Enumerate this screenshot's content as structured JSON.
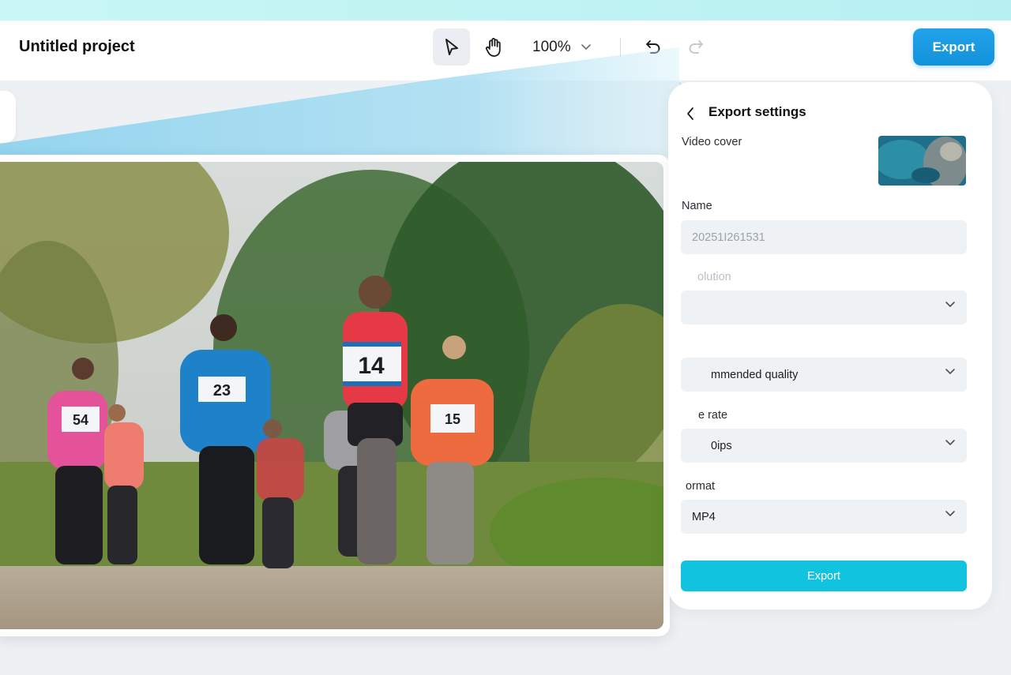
{
  "header": {
    "project_title": "Untitled project",
    "zoom_value": "100%",
    "export_label": "Export"
  },
  "export_panel": {
    "title": "Export settings",
    "video_cover_label": "Video cover",
    "name_label": "Name",
    "name_value": "20251I261531",
    "resolution_label": "olution",
    "resolution_value": "",
    "quality_label": "",
    "quality_value": "mmended quality",
    "frame_rate_label": "e rate",
    "frame_rate_value": "0ips",
    "format_label": "ormat",
    "format_value": "MP4",
    "export_button": "Export"
  },
  "colors": {
    "accent": "#1292dc",
    "export_button": "#12c3e0",
    "top_strip": "#c9f6f6"
  },
  "canvas": {
    "runner_bibs": [
      "54",
      "23",
      "14",
      "15"
    ]
  }
}
